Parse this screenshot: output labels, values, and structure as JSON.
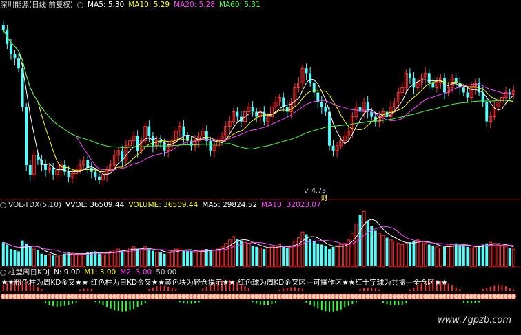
{
  "price_panel": {
    "stock_name": "深圳能源",
    "period": "(日线 前复权)",
    "ma5_label": "MA5: 5.30",
    "ma10_label": "MA10: 5.29",
    "ma20_label": "MA20: 5.28",
    "ma60_label": "MA60: 5.31",
    "low_marker": "4.73",
    "fin_marker": "财",
    "colors": {
      "ma5": "#ffffff",
      "ma10": "#ffff00",
      "ma20": "#ff44ff",
      "ma60": "#44ff44",
      "up": "#ff3030",
      "down": "#54ffff"
    }
  },
  "vol_panel": {
    "title": "VOL-TDX(5,10)",
    "vvol": "VVOL: 36509.44",
    "volume": "VOLUME: 36509.44",
    "ma5": "MA5: 29824.52",
    "ma10": "MA10: 32023.07"
  },
  "kdj_panel": {
    "title": "柱型周日KDJ",
    "n": "N: 9.00",
    "m1": "M1: 3.00",
    "m2": "M2: 3.00",
    "extra": "50.00",
    "legend": "★★粉色柱为周KD金叉★★ 红色柱为日KD金叉★★黄色块为轻仓提示★★ 红色球为周KD金叉区—可操作区★★红十字球为共振—全仓区★★"
  },
  "watermark": "www.7gpzb.com",
  "chart_data": {
    "type": "candlestick",
    "series_names": [
      "MA5",
      "MA10",
      "MA20",
      "MA60",
      "VOLUME",
      "VOL MA5",
      "VOL MA10"
    ],
    "last_values": {
      "MA5": 5.3,
      "MA10": 5.29,
      "MA20": 5.28,
      "MA60": 5.31,
      "VOLUME": 36509.44,
      "VOL_MA5": 29824.52,
      "VOL_MA10": 32023.07
    },
    "annotations": [
      "4.73",
      "财"
    ],
    "closes": [
      6.35,
      6.2,
      6.1,
      6.05,
      5.95,
      5.55,
      4.95,
      4.85,
      5.05,
      5.0,
      4.95,
      4.9,
      4.92,
      4.85,
      4.9,
      4.95,
      4.88,
      4.82,
      4.86,
      4.9,
      4.95,
      5.0,
      4.92,
      4.88,
      4.83,
      4.8,
      4.85,
      4.9,
      4.95,
      5.05,
      5.1,
      5.0,
      5.15,
      5.2,
      5.25,
      5.1,
      5.2,
      5.35,
      5.25,
      5.15,
      5.2,
      5.18,
      5.1,
      5.15,
      5.2,
      5.3,
      5.35,
      5.25,
      5.2,
      5.15,
      5.2,
      5.25,
      5.3,
      5.2,
      5.1,
      5.15,
      5.2,
      5.25,
      5.35,
      5.4,
      5.5,
      5.45,
      5.4,
      5.5,
      5.55,
      5.5,
      5.45,
      5.5,
      5.4,
      5.45,
      5.55,
      5.6,
      5.65,
      5.55,
      5.5,
      5.6,
      5.75,
      5.8,
      5.95,
      5.9,
      5.8,
      5.7,
      5.6,
      5.55,
      5.5,
      5.15,
      5.1,
      5.15,
      5.2,
      5.25,
      5.3,
      5.45,
      5.55,
      5.5,
      5.6,
      5.5,
      5.45,
      5.4,
      5.45,
      5.5,
      5.45,
      5.55,
      5.6,
      5.7,
      5.75,
      5.9,
      5.85,
      5.75,
      5.8,
      5.85,
      5.9,
      5.8,
      5.75,
      5.8,
      5.85,
      5.7,
      5.75,
      5.85,
      5.8,
      5.75,
      5.7,
      5.65,
      5.75,
      5.8,
      5.7,
      5.6,
      5.4,
      5.45,
      5.55,
      5.6,
      5.65,
      5.7,
      5.68,
      5.72
    ],
    "volumes": [
      42,
      38,
      30,
      28,
      26,
      45,
      40,
      34,
      30,
      28,
      22,
      20,
      21,
      19,
      18,
      20,
      22,
      24,
      23,
      21,
      20,
      22,
      24,
      25,
      26,
      22,
      20,
      24,
      26,
      28,
      30,
      26,
      28,
      32,
      34,
      30,
      28,
      34,
      30,
      27,
      25,
      24,
      22,
      24,
      26,
      30,
      32,
      29,
      27,
      26,
      24,
      26,
      28,
      30,
      29,
      28,
      30,
      34,
      40,
      46,
      52,
      48,
      44,
      42,
      40,
      36,
      34,
      32,
      30,
      32,
      34,
      36,
      38,
      34,
      32,
      36,
      44,
      50,
      60,
      56,
      48,
      44,
      40,
      38,
      36,
      30,
      34,
      36,
      38,
      40,
      46,
      58,
      74,
      90,
      96,
      80,
      70,
      62,
      58,
      54,
      50,
      46,
      44,
      40,
      38,
      40,
      42,
      44,
      46,
      44,
      40,
      38,
      36,
      34,
      32,
      34,
      36,
      38,
      40,
      38,
      36,
      34,
      32,
      34,
      36,
      38,
      40,
      42,
      40,
      38,
      36,
      34,
      32,
      30
    ]
  }
}
